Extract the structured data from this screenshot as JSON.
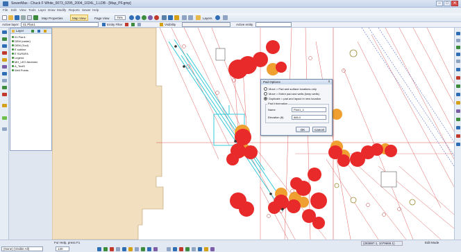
{
  "window": {
    "title": "SewerMax - Chuck F White_0073_0295_2004_1024L_1.LDB - [Map_PF.gmp]",
    "minimize": "–",
    "maximize": "□",
    "close": "✕"
  },
  "menu": [
    "File",
    "Edit",
    "View",
    "Tools",
    "Layer",
    "Draw",
    "Modify",
    "Reports",
    "Sewer",
    "Help"
  ],
  "toolbar": {
    "map_properties": "Map Properties",
    "map_view": "Map View",
    "page_view": "Page View",
    "zoom": "75%",
    "layers": "Layers",
    "icon_colors": [
      "#2f6db5",
      "#3d8c3d",
      "#c0392b",
      "#d4a017",
      "#7b5ea7"
    ]
  },
  "layerbar": {
    "active_layer_label": "Active layer:",
    "active_layer_value": "01 Plan1",
    "entity_filter": "Entity Filter",
    "visibility": "Visibility",
    "active_entity": "Active entity"
  },
  "layers_panel": {
    "title": "Layer",
    "rows": [
      "01 Plan1",
      "DEM (raster)",
      "DEM (Tool)",
      "E subline",
      "E SURAFA",
      "Legend",
      "MH_LEO Abutmen",
      "A_TextS",
      "Well Points"
    ]
  },
  "dialog": {
    "title": "Pad Options",
    "close": "x",
    "options": [
      "Move = Pad and surface locations only",
      "Move = Entire pad and wells (keep wells)",
      "Duplicate = pad and layout in new location"
    ],
    "selected_option_index": 2,
    "info_group": "Pad Information",
    "name_label": "Name",
    "name_value": "Plan1_4",
    "elevation_label": "Elevation (ft)",
    "elevation_value": "886.0",
    "ok": "OK",
    "cancel": "Cancel"
  },
  "status": {
    "help": "For Help, press F1",
    "layer_select": "(None) (Visible All)",
    "coords": "(283887.1, 1079665.1)",
    "mode": "Edit Mode",
    "zoom_value": "130"
  }
}
